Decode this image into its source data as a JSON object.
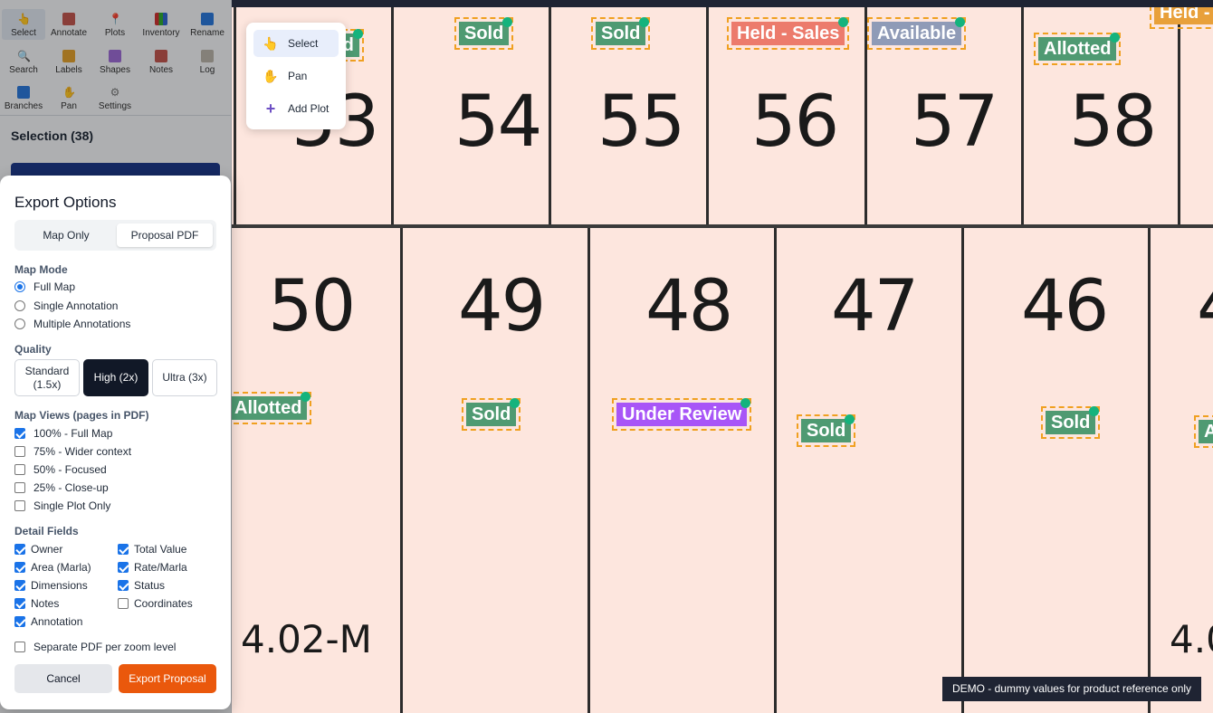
{
  "toolbar": {
    "tools": [
      {
        "label": "Select",
        "icon": "pointer-hand-icon"
      },
      {
        "label": "Annotate",
        "icon": "annotate-icon"
      },
      {
        "label": "Plots",
        "icon": "pin-icon"
      },
      {
        "label": "Inventory",
        "icon": "bar-chart-icon"
      },
      {
        "label": "Rename",
        "icon": "rename-icon"
      },
      {
        "label": "Search",
        "icon": "search-icon"
      },
      {
        "label": "Labels",
        "icon": "tag-icon"
      },
      {
        "label": "Shapes",
        "icon": "shapes-icon"
      },
      {
        "label": "Notes",
        "icon": "notes-icon"
      },
      {
        "label": "Log",
        "icon": "log-icon"
      },
      {
        "label": "Branches",
        "icon": "branches-icon"
      },
      {
        "label": "Pan",
        "icon": "hand-icon"
      },
      {
        "label": "Settings",
        "icon": "gear-icon"
      }
    ]
  },
  "selection": {
    "title": "Selection (38)"
  },
  "export": {
    "title": "Export Options",
    "tabs": [
      "Map Only",
      "Proposal PDF"
    ],
    "active_tab": "Proposal PDF",
    "map_mode_label": "Map Mode",
    "map_modes": [
      {
        "label": "Full Map",
        "selected": true
      },
      {
        "label": "Single Annotation",
        "selected": false
      },
      {
        "label": "Multiple Annotations",
        "selected": false
      }
    ],
    "quality_label": "Quality",
    "quality": {
      "standard_line1": "Standard",
      "standard_line2": "(1.5x)",
      "high": "High (2x)",
      "ultra": "Ultra (3x)",
      "selected": "High (2x)"
    },
    "views_label": "Map Views (pages in PDF)",
    "views": [
      {
        "label": "100% - Full Map",
        "checked": true
      },
      {
        "label": "75% - Wider context",
        "checked": false
      },
      {
        "label": "50% - Focused",
        "checked": false
      },
      {
        "label": "25% - Close-up",
        "checked": false
      },
      {
        "label": "Single Plot Only",
        "checked": false
      }
    ],
    "fields_label": "Detail Fields",
    "fields": [
      {
        "label": "Owner",
        "checked": true
      },
      {
        "label": "Total Value",
        "checked": true
      },
      {
        "label": "Area (Marla)",
        "checked": true
      },
      {
        "label": "Rate/Marla",
        "checked": true
      },
      {
        "label": "Dimensions",
        "checked": true
      },
      {
        "label": "Status",
        "checked": true
      },
      {
        "label": "Notes",
        "checked": true
      },
      {
        "label": "Coordinates",
        "checked": false
      },
      {
        "label": "Annotation",
        "checked": true
      }
    ],
    "separate_pdf": {
      "label": "Separate PDF per zoom level",
      "checked": false
    },
    "cancel": "Cancel",
    "submit": "Export Proposal"
  },
  "tool_popup": {
    "items": [
      {
        "label": "Select",
        "icon": "pointer-hand-icon",
        "active": true
      },
      {
        "label": "Pan",
        "icon": "hand-icon",
        "active": false
      },
      {
        "label": "Add Plot",
        "icon": "plus-icon",
        "active": false
      }
    ]
  },
  "map": {
    "top_row": [
      "53",
      "54",
      "55",
      "56",
      "57",
      "58"
    ],
    "bottom_row": [
      "50",
      "49",
      "48",
      "47",
      "46",
      "4"
    ],
    "area_labels": [
      "4.02-M",
      "4.0"
    ],
    "tags": [
      {
        "text": "...d",
        "status": "Sold",
        "color": "#4f9a72"
      },
      {
        "text": "Sold",
        "color": "#4f9a72"
      },
      {
        "text": "Sold",
        "color": "#4f9a72"
      },
      {
        "text": "Held - Sales",
        "color": "#ec7b6c"
      },
      {
        "text": "Available",
        "color": "#8f9bb7"
      },
      {
        "text": "Allotted",
        "color": "#4f9a72"
      },
      {
        "text": "Held -",
        "color": "#e8a03a"
      },
      {
        "text": "Allotted",
        "color": "#4f9a72"
      },
      {
        "text": "Sold",
        "color": "#4f9a72"
      },
      {
        "text": "Under Review",
        "color": "#a855f7"
      },
      {
        "text": "Sold",
        "color": "#4f9a72"
      },
      {
        "text": "Sold",
        "color": "#4f9a72"
      },
      {
        "text": "A",
        "color": "#4f9a72"
      }
    ]
  },
  "demo_note": "DEMO - dummy values for product reference only"
}
